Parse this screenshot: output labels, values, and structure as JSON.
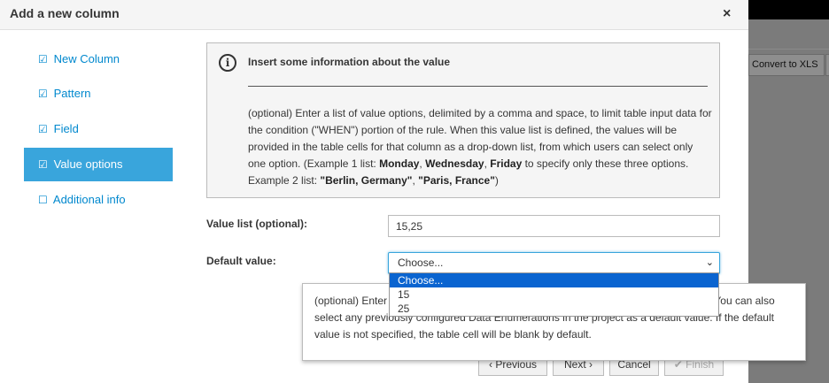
{
  "background": {
    "toolbar_button": "Convert to XLS"
  },
  "modal": {
    "title": "Add a new column",
    "close_label": "×"
  },
  "nav": {
    "items": [
      {
        "label": "New Column",
        "icon": "☑"
      },
      {
        "label": "Pattern",
        "icon": "☑"
      },
      {
        "label": "Field",
        "icon": "☑"
      },
      {
        "label": "Value options",
        "icon": "☑"
      },
      {
        "label": "Additional info",
        "icon": "☐"
      }
    ]
  },
  "info": {
    "title": "Insert some information about the value",
    "desc_1": "(optional) Enter a list of value options, delimited by a comma and space, to limit table input data for the condition (\"WHEN\") portion of the rule. When this value list is defined, the values will be provided in the table cells for that column as a drop-down list, from which users can select only one option. (Example 1 list: ",
    "ex1_a": "Monday",
    "sep_1": ", ",
    "ex1_b": "Wednesday",
    "sep_2": ", ",
    "ex1_c": "Friday",
    "desc_2": " to specify only these three options. Example 2 list: ",
    "ex2_a": "\"Berlin, Germany\"",
    "sep_3": ", ",
    "ex2_b": "\"Paris, France\"",
    "desc_3": ")"
  },
  "form": {
    "value_list_label": "Value list (optional):",
    "value_list_value": "15,25",
    "default_value_label": "Default value:",
    "default_selected": "Choose...",
    "options": [
      "Choose...",
      "15",
      "25"
    ]
  },
  "popover": {
    "text": "(optional) Enter a default value that will appear in the cell automatically in a new row. You can also select any previously configured Data Enumerations in the project as a default value. If the default value is not specified, the table cell will be blank by default."
  },
  "footer": {
    "previous": "‹ Previous",
    "next": "Next ›",
    "cancel": "Cancel",
    "finish": "✔ Finish"
  }
}
